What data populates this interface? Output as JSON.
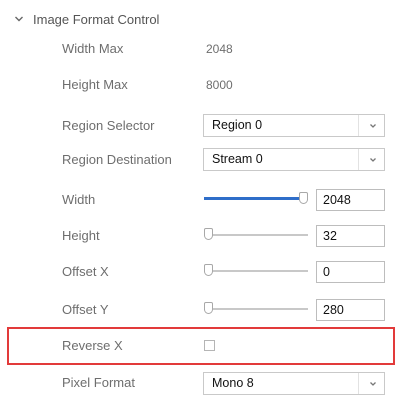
{
  "section": {
    "title": "Image Format Control",
    "icon": "chevron-down-icon"
  },
  "properties": {
    "width_max": {
      "label": "Width Max",
      "value": "2048"
    },
    "height_max": {
      "label": "Height Max",
      "value": "8000"
    },
    "region_selector": {
      "label": "Region Selector",
      "value": "Region 0"
    },
    "region_destination": {
      "label": "Region Destination",
      "value": "Stream 0"
    },
    "width": {
      "label": "Width",
      "value": "2048",
      "slider_fraction": 1.0
    },
    "height": {
      "label": "Height",
      "value": "32",
      "slider_fraction": 0.0
    },
    "offset_x": {
      "label": "Offset X",
      "value": "0",
      "slider_fraction": 0.0
    },
    "offset_y": {
      "label": "Offset Y",
      "value": "280",
      "slider_fraction": 0.04
    },
    "reverse_x": {
      "label": "Reverse X",
      "checked": false
    },
    "pixel_format": {
      "label": "Pixel Format",
      "value": "Mono 8"
    }
  },
  "colors": {
    "slider_fill": "#2f6ec9",
    "highlight_border": "#e23a3a"
  }
}
